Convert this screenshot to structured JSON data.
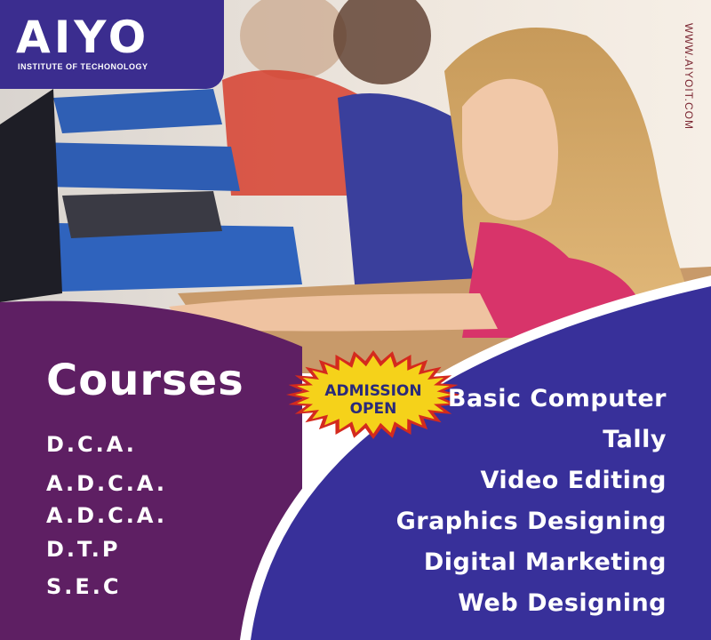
{
  "brand": {
    "name": "AIYO",
    "tagline": "INSTITUTE OF TECHONOLOGY",
    "website": "WWW.AIYOIT.COM"
  },
  "badge": {
    "line1": "ADMISSION",
    "line2": "OPEN"
  },
  "left_panel": {
    "title": "Courses",
    "items": [
      "D.C.A.",
      "A.D.C.A.",
      "A.D.C.A.",
      "D.T.P",
      "S.E.C"
    ]
  },
  "right_panel": {
    "items": [
      "Basic Computer",
      "Tally",
      "Video Editing",
      "Graphics Designing",
      "Digital Marketing",
      "Web Designing"
    ]
  },
  "colors": {
    "logo_bg": "#3b2d8f",
    "left_panel": "#5e1f63",
    "right_panel": "#38309a",
    "badge_outer": "#d42a1e",
    "badge_inner": "#f5d21a",
    "badge_text": "#2a2a7a"
  }
}
